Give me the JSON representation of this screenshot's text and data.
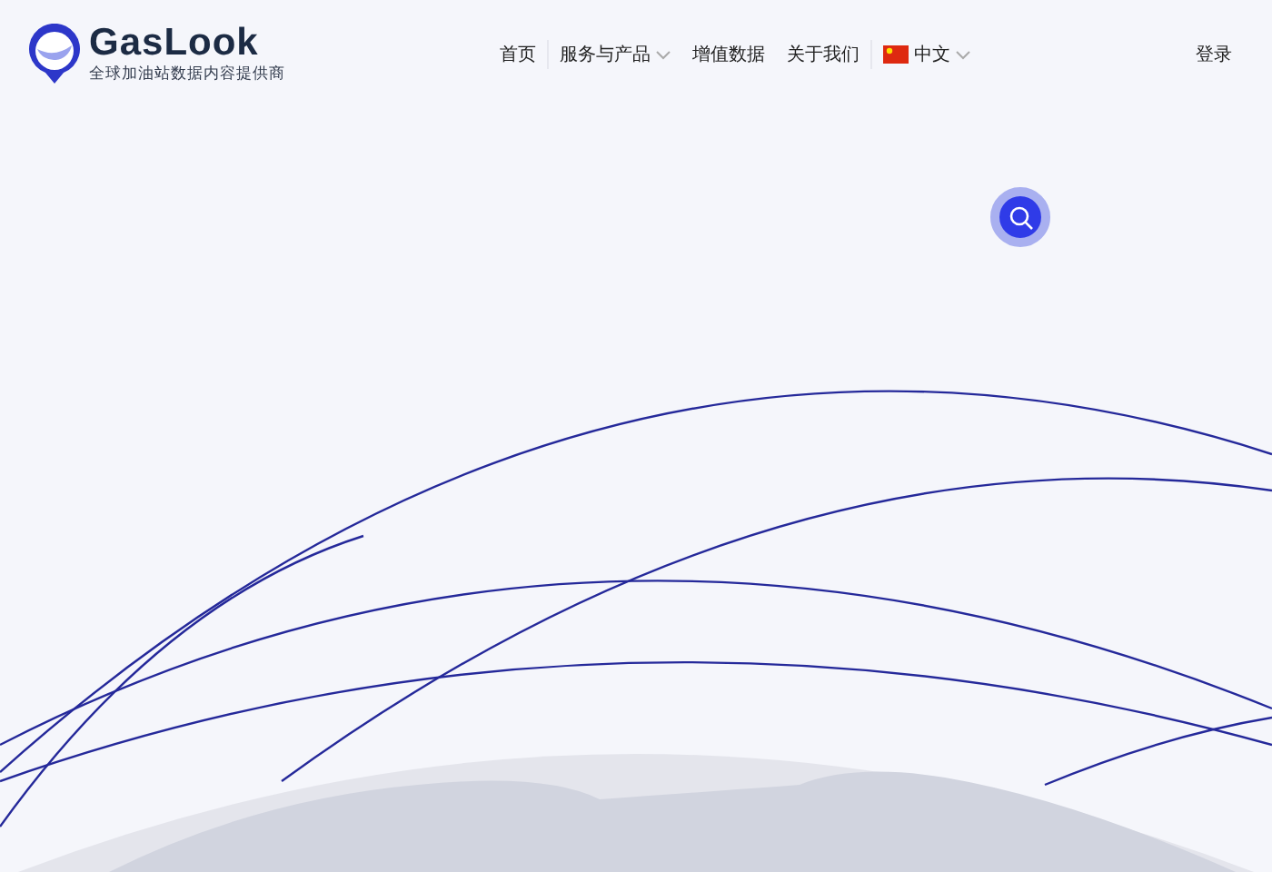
{
  "brand": {
    "name": "GasLook",
    "tagline": "全球加油站数据内容提供商"
  },
  "nav": [
    {
      "label": "首页",
      "dropdown": false
    },
    {
      "label": "服务与产品",
      "dropdown": true
    },
    {
      "label": "增值数据",
      "dropdown": false
    },
    {
      "label": "关于我们",
      "dropdown": false
    }
  ],
  "language": {
    "label": "中文",
    "dropdown": true
  },
  "login": "登录"
}
